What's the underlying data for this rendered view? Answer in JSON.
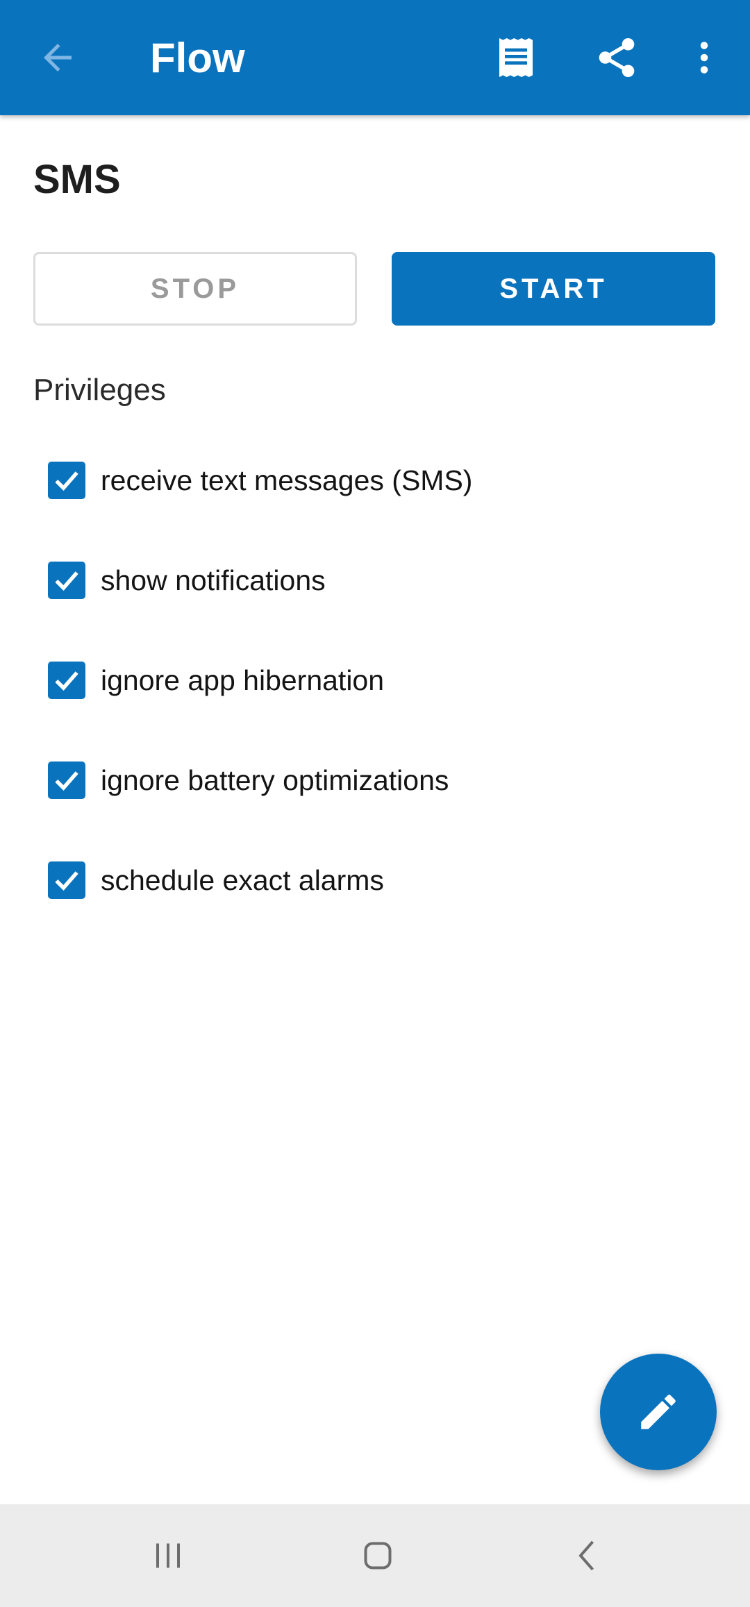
{
  "appbar": {
    "title": "Flow",
    "background_color": "#0a73bd",
    "icons": [
      "arrow-back-icon",
      "receipt-log-icon",
      "share-icon",
      "more-vert-icon"
    ]
  },
  "flow": {
    "name": "SMS"
  },
  "buttons": {
    "stop_label": "STOP",
    "start_label": "START"
  },
  "privileges": {
    "title": "Privileges",
    "items": [
      {
        "label": "receive text messages (SMS)",
        "checked": true
      },
      {
        "label": "show notifications",
        "checked": true
      },
      {
        "label": "ignore app hibernation",
        "checked": true
      },
      {
        "label": "ignore battery optimizations",
        "checked": true
      },
      {
        "label": "schedule exact alarms",
        "checked": true
      }
    ]
  },
  "fab": {
    "icon": "edit-pencil-icon"
  },
  "navbar": {
    "icons": [
      "recents-icon",
      "home-icon",
      "nav-back-icon"
    ]
  }
}
